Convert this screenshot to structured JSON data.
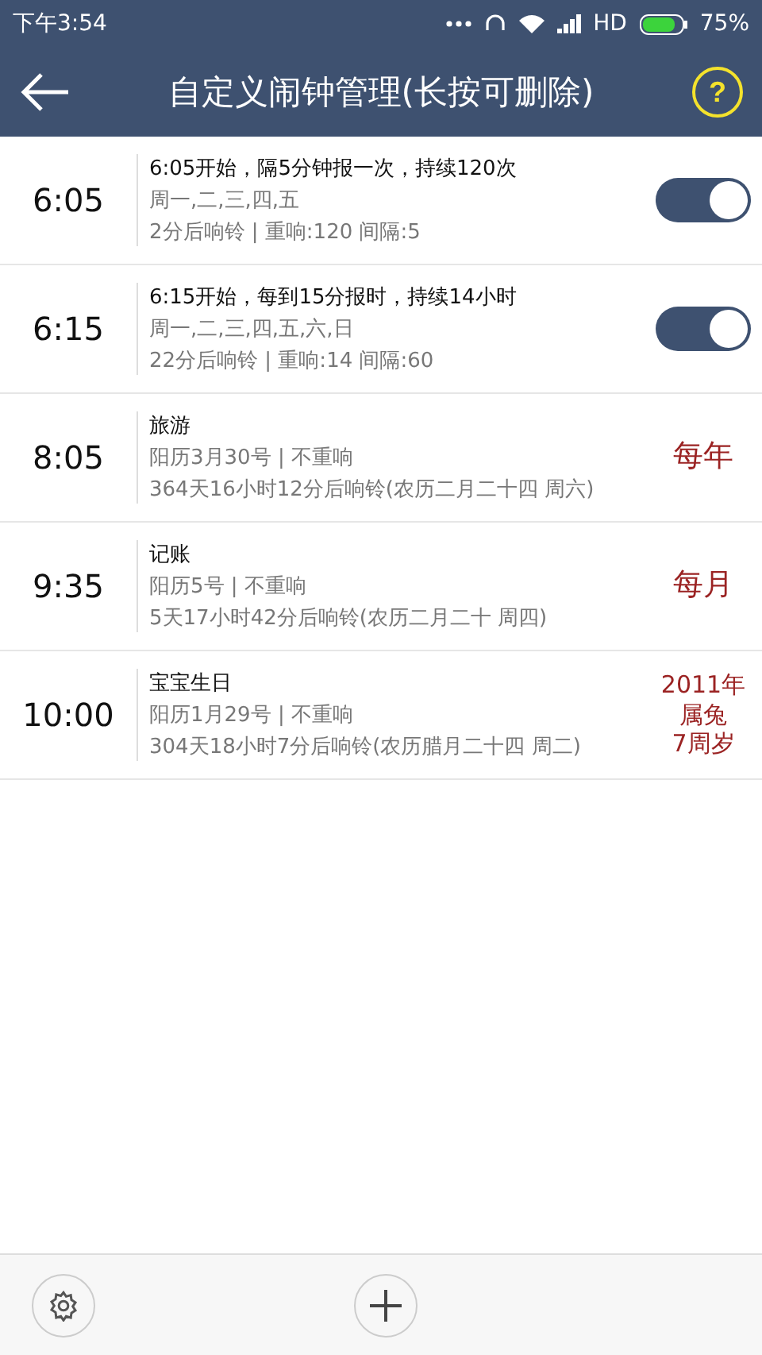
{
  "status_bar": {
    "time": "下午3:54",
    "network": "HD",
    "battery": "75%"
  },
  "header": {
    "title": "自定义闹钟管理(长按可删除)",
    "help": "?"
  },
  "alarms": [
    {
      "kind": "switch",
      "time": "6:05",
      "title": "6:05开始，隔5分钟报一次，持续120次",
      "line_2": "周一,二,三,四,五",
      "line_3": "2分后响铃 | 重响:120  间隔:5",
      "on": true
    },
    {
      "kind": "switch",
      "time": "6:15",
      "title": "6:15开始，每到15分报时，持续14小时",
      "line_2": "周一,二,三,四,五,六,日",
      "line_3": "22分后响铃 | 重响:14  间隔:60",
      "on": true
    },
    {
      "kind": "repeat",
      "time": "8:05",
      "title": "旅游",
      "line_2": "阳历3月30号 | 不重响",
      "line_3": "364天16小时12分后响铃(农历二月二十四 周六)",
      "repeat": [
        "每年"
      ]
    },
    {
      "kind": "repeat",
      "time": "9:35",
      "title": "记账",
      "line_2": "阳历5号 | 不重响",
      "line_3": "5天17小时42分后响铃(农历二月二十 周四)",
      "repeat": [
        "每月"
      ]
    },
    {
      "kind": "repeat",
      "time": "10:00",
      "title": "宝宝生日",
      "line_2": "阳历1月29号 | 不重响",
      "line_3": "304天18小时7分后响铃(农历腊月二十四 周二)",
      "repeat": [
        "2011年",
        "属兔",
        "7周岁"
      ]
    }
  ]
}
